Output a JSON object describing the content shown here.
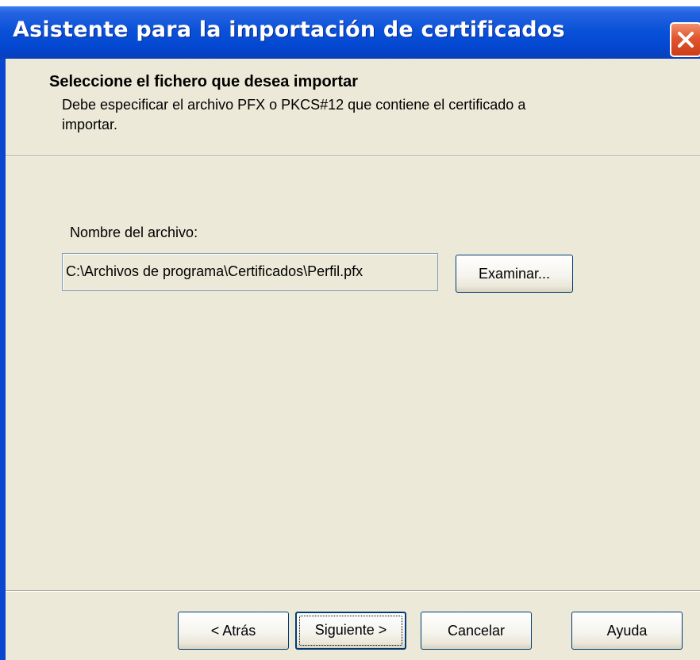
{
  "window": {
    "title": "Asistente para la importación de certificados",
    "close_icon": "close-icon"
  },
  "header": {
    "title": "Seleccione el fichero que desea importar",
    "description": "Debe especificar el archivo PFX o PKCS#12 que contiene el certificado a importar."
  },
  "file": {
    "label": "Nombre del archivo:",
    "value": "C:\\Archivos de programa\\Certificados\\Perfil.pfx",
    "browse_label": "Examinar..."
  },
  "footer": {
    "back_label": "< Atrás",
    "next_label": "Siguiente >",
    "cancel_label": "Cancelar",
    "help_label": "Ayuda"
  },
  "colors": {
    "titlebar": "#0a52d9",
    "dialog_background": "#ece9d8",
    "close_button": "#e2552e",
    "button_border": "#003c74"
  }
}
